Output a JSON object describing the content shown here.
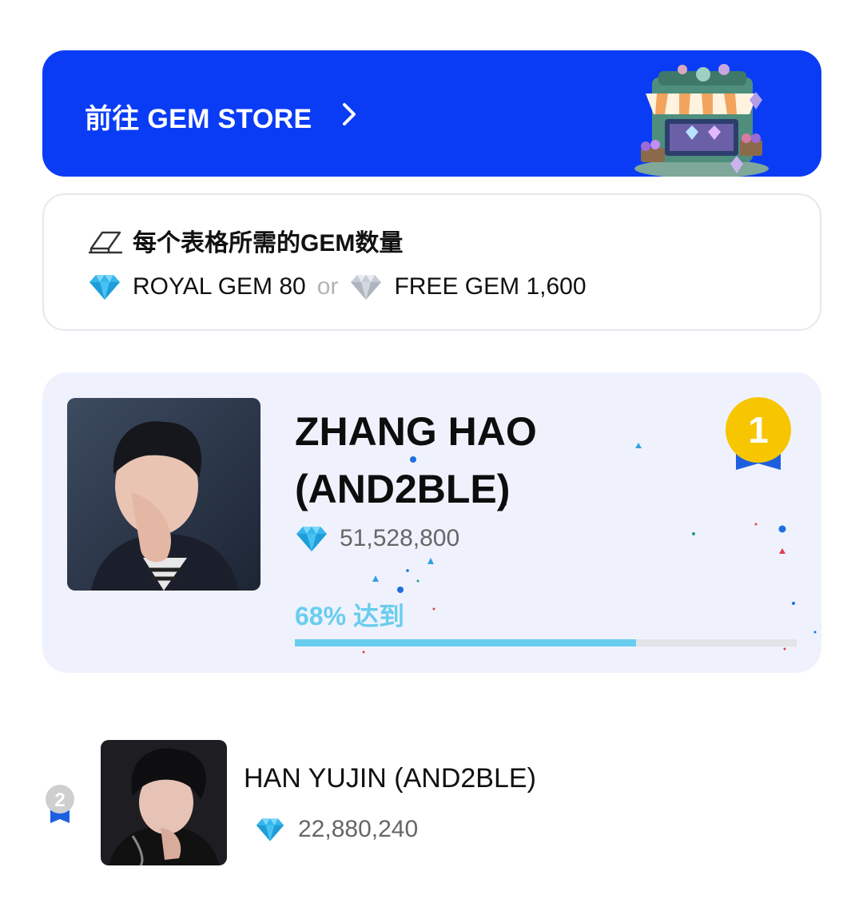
{
  "store_banner": {
    "label": "前往 GEM STORE",
    "icon": "chevron-right-icon",
    "art": "gem-store-illustration",
    "background": "#0a3cf5"
  },
  "info": {
    "icon": "eraser-icon",
    "title": "每个表格所需的GEM数量",
    "royal_gem_label": "ROYAL GEM 80",
    "or_label": "or",
    "free_gem_label": "FREE GEM 1,600",
    "royal_gem_icon": "blue-diamond-icon",
    "free_gem_icon": "silver-diamond-icon"
  },
  "featured": {
    "rank": "1",
    "name_line1": "ZHANG HAO",
    "name_line2": "(AND2BLE)",
    "gems": "51,528,800",
    "progress_label": "68% 达到",
    "progress_fraction": 0.68,
    "accent": "#69cdee"
  },
  "ranking": [
    {
      "rank": "2",
      "name": "HAN YUJIN (AND2BLE)",
      "gems": "22,880,240"
    }
  ]
}
